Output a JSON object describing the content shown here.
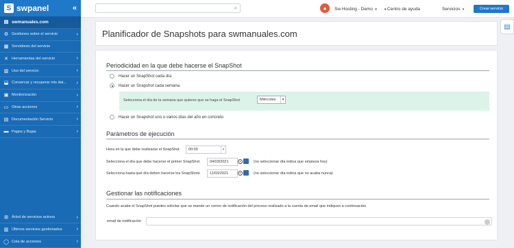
{
  "sidebar": {
    "logo": "swpanel",
    "collapse_icon": "double-chevron-left-icon",
    "domain": "swmanuales.com",
    "items": [
      {
        "label": "Gestiones sobre el servicio",
        "icon": "gears-icon",
        "chevron": true
      },
      {
        "label": "Servidores del servicio",
        "icon": "server-icon",
        "chevron": false
      },
      {
        "label": "Herramientas del servicio",
        "icon": "tools-icon",
        "chevron": true
      },
      {
        "label": "Uso del servicio",
        "icon": "chart-icon",
        "chevron": true
      },
      {
        "label": "Conservar y recuperar mis dat...",
        "icon": "backup-icon",
        "chevron": true
      },
      {
        "label": "Monitorización",
        "icon": "monitor-icon",
        "chevron": true
      },
      {
        "label": "Otras acciones",
        "icon": "folder-icon",
        "chevron": true
      },
      {
        "label": "Documentación Servicio",
        "icon": "docs-icon",
        "chevron": true
      },
      {
        "label": "Pagos y Bajas",
        "icon": "payments-icon",
        "chevron": true
      }
    ],
    "bottom_items": [
      {
        "label": "Árbol de servicios activos",
        "icon": "tree-icon"
      },
      {
        "label": "Últimos servicios gestionados",
        "icon": "history-icon"
      },
      {
        "label": "Cola de acciones",
        "icon": "queue-icon"
      }
    ]
  },
  "topbar": {
    "search_placeholder": "",
    "account": "Sw Hosting - Demo",
    "help": "Centro de ayuda",
    "services": "Servicios",
    "new_service": "Crear servicio"
  },
  "page": {
    "title": "Planificador de Snapshots para swmanuales.com"
  },
  "periodicity": {
    "title": "Periodicidad en la que debe hacerse el SnapShot",
    "options": [
      {
        "label": "Hacer un SnapShot cada día",
        "selected": false
      },
      {
        "label": "Hacer un Snapshot cada semana",
        "selected": true
      },
      {
        "label": "Hacer un Snapshot uno o varios días del año en concreto",
        "selected": false
      }
    ],
    "weekday_label": "Selecciona el día de la semana que quieres que se haga el SnapShot",
    "weekday_value": "Miércoles"
  },
  "execution": {
    "title": "Parámetros de ejecución",
    "time_label": "Hora en la que debe realizarse el SnapShot",
    "time_value": "00:00",
    "first_label": "Selecciona el día que debe hacerse el primer SnapShot",
    "first_date": "04/03/2021",
    "first_hint": "(no seleccionar día indica que empieza hoy)",
    "last_label": "Selecciona hasta qué día deben hacerse los SnapShots",
    "last_date": "11/03/2021",
    "last_hint": "(no seleccionar día indica que no acaba nunca)"
  },
  "notifications": {
    "title": "Gestionar las notificaciones",
    "description": "Cuando acabe el SnapShot puedes solicitar que se mande un correo de notificación del proceso realizado a la cuenta de email que indiques a continuación.",
    "email_label": "email de notificación",
    "email_value": ""
  },
  "colors": {
    "sidebar": "#1a6bb5",
    "accent": "#1f78c8",
    "highlight_box": "#dcf3ea"
  }
}
